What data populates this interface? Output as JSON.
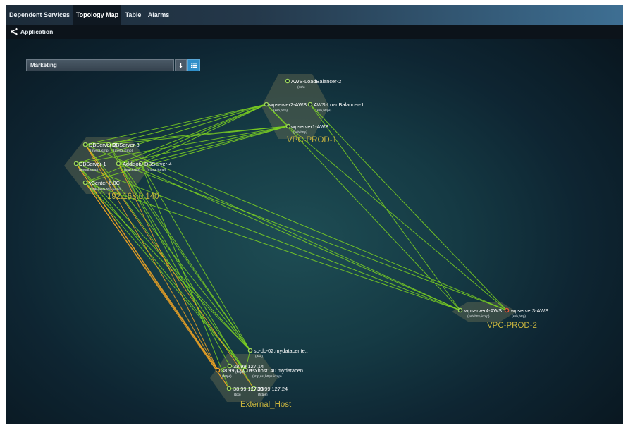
{
  "tabs": [
    {
      "label": "Dependent Services",
      "active": false
    },
    {
      "label": "Topology Map",
      "active": true
    },
    {
      "label": "Table",
      "active": false
    },
    {
      "label": "Alarms",
      "active": false
    }
  ],
  "breadcrumb": {
    "label": "Application",
    "icon": "share-icon"
  },
  "app_selector": {
    "value": "Marketing",
    "sort_icon": "arrow-down-icon",
    "list_icon": "list-icon"
  },
  "colors": {
    "accent": "#2f8fc9",
    "edge_green": "#7ed321",
    "edge_orange": "#f5a623",
    "group_label": "#c7b33e",
    "node_ok": "#9bd35b",
    "node_warn": "#f5a623",
    "node_critical": "#e55a3a"
  },
  "groups": [
    {
      "name": "VPC-PROD-1"
    },
    {
      "name": "192.168.0.140"
    },
    {
      "name": "VPC-PROD-2"
    },
    {
      "name": "External_Host"
    }
  ],
  "nodes": [
    {
      "id": "lb2",
      "name": "AWS-LoadBalancer-2",
      "protocols": "(ssh)",
      "status": "ok"
    },
    {
      "id": "wp2",
      "name": "wpserver2-AWS",
      "protocols": "(ssh,http)",
      "status": "ok"
    },
    {
      "id": "lb1",
      "name": "AWS-LoadBalancer-1",
      "protocols": "(ssh,https)",
      "status": "ok"
    },
    {
      "id": "wp1",
      "name": "wpserver1-AWS",
      "protocols": "(ssh,http)",
      "status": "ok"
    },
    {
      "id": "db2",
      "name": "DBServer-2",
      "protocols": "(mysql,icmp)",
      "status": "ok"
    },
    {
      "id": "db3",
      "name": "DBServer-3",
      "protocols": "(mysql,icmp)",
      "status": "ok"
    },
    {
      "id": "db1",
      "name": "DBServer-1",
      "protocols": "(mysql,icmp)",
      "status": "ok"
    },
    {
      "id": "add",
      "name": "Addison",
      "protocols": "(http,icmp)",
      "status": "ok"
    },
    {
      "id": "db4",
      "name": "DBServer-4",
      "protocols": "(mysql,icmp)",
      "status": "ok"
    },
    {
      "id": "vc",
      "name": "vCenter-6.0C",
      "protocols": "(http,https,ssh,icmp)",
      "status": "ok"
    },
    {
      "id": "wp4",
      "name": "wpserver4-AWS",
      "protocols": "(ssh,http,icmp)",
      "status": "ok"
    },
    {
      "id": "wp3",
      "name": "wpserver3-AWS",
      "protocols": "(ssh,http)",
      "status": "critical"
    },
    {
      "id": "sc",
      "name": "sc-dc-02.mydatacente..",
      "protocols": "(dns)",
      "status": "ok"
    },
    {
      "id": "e14",
      "name": "38.99.127.14",
      "protocols": "(https)",
      "status": "ok"
    },
    {
      "id": "esx",
      "name": "esxhost140.mydatacen..",
      "protocols": "(http,ssl,https,icmp)",
      "status": "ok"
    },
    {
      "id": "e10",
      "name": "38.99.127.10",
      "protocols": "(https)",
      "status": "warn"
    },
    {
      "id": "e23",
      "name": "38.99.127.23",
      "protocols": "(tcp)",
      "status": "ok"
    },
    {
      "id": "e24",
      "name": "38.99.127.24",
      "protocols": "(https)",
      "status": "ok"
    }
  ]
}
